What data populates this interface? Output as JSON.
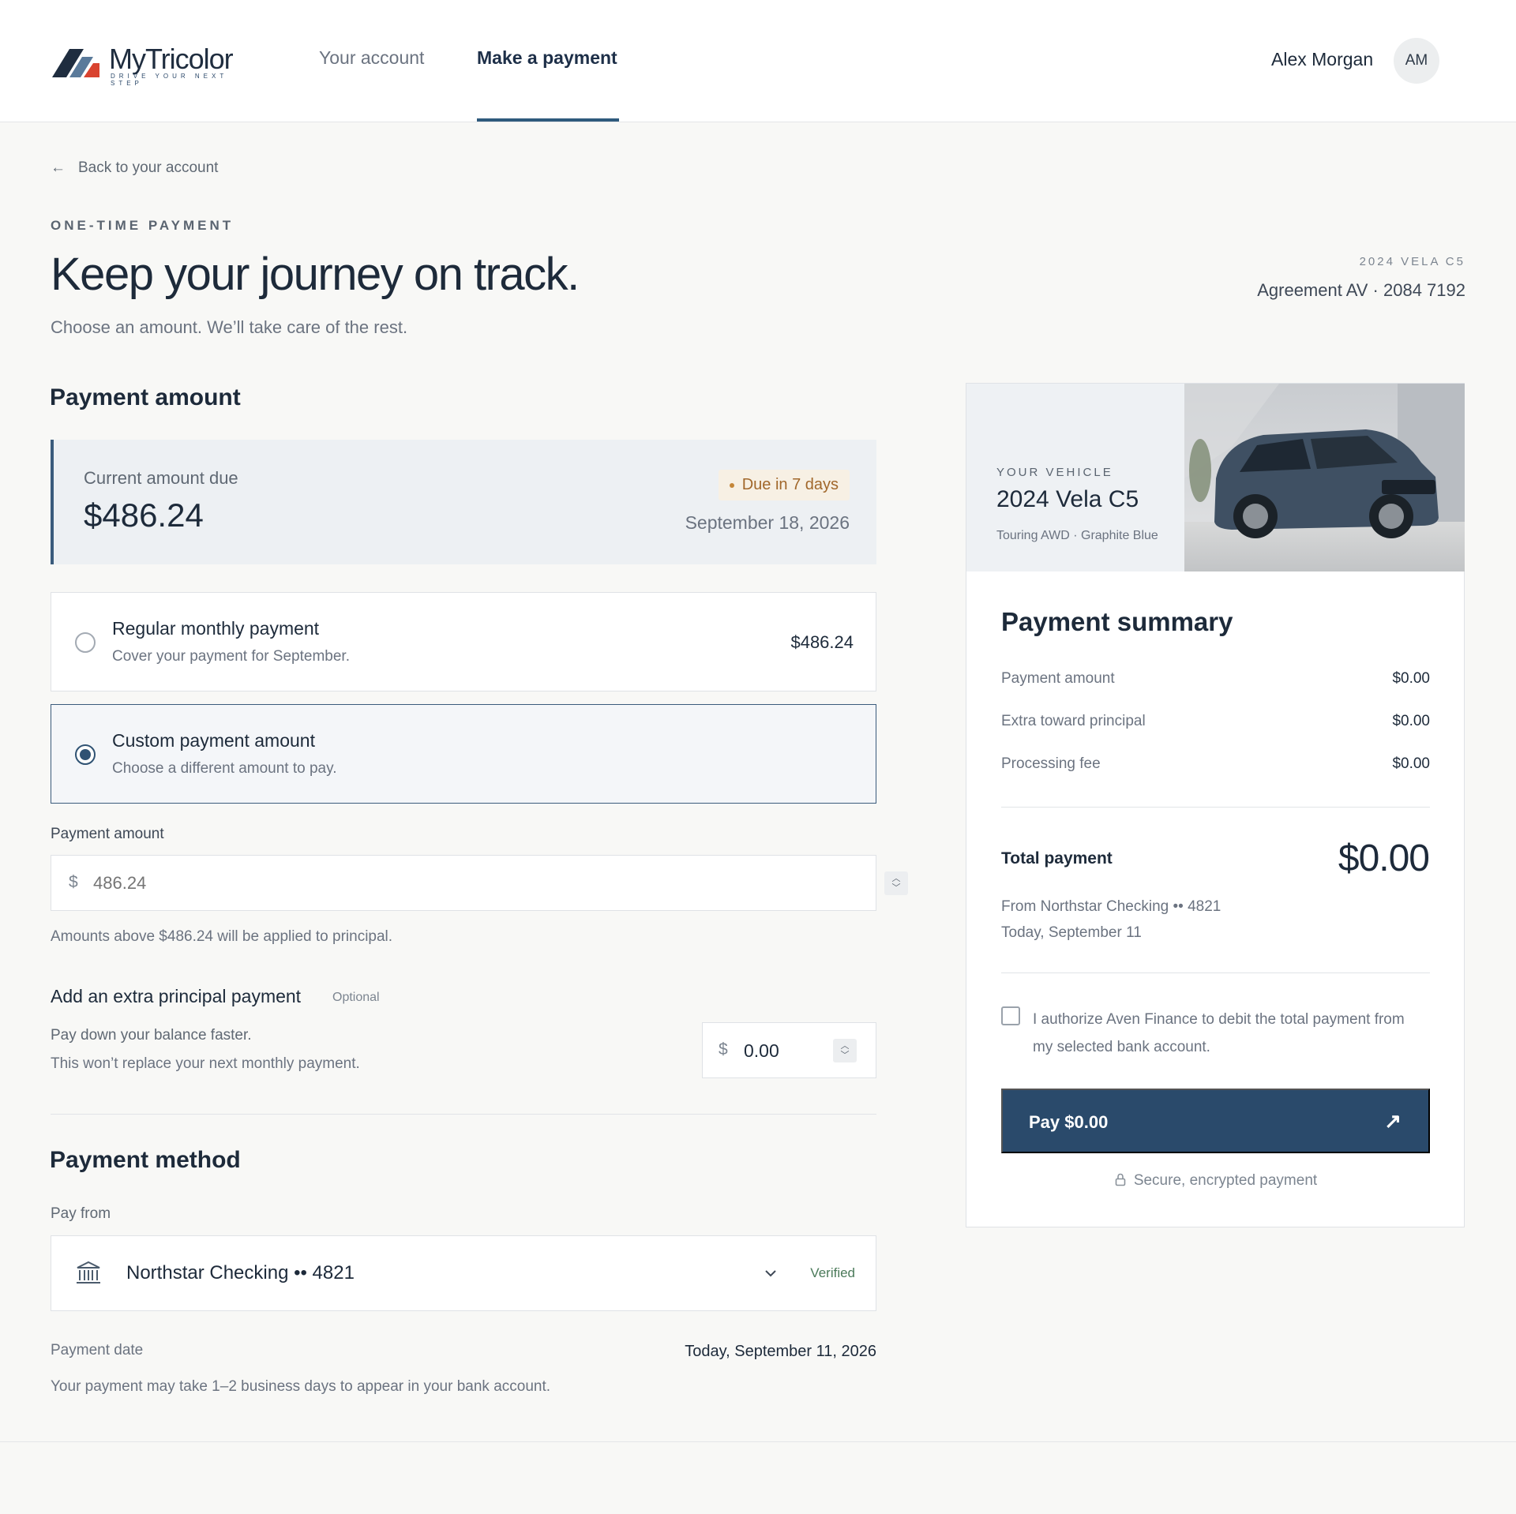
{
  "brand": {
    "name": "MyTricolor",
    "tagline": "DRIVE YOUR NEXT STEP",
    "colors": {
      "navy": "#1f2d3f",
      "blue": "#5a7a9a",
      "red": "#d9432f",
      "accent": "#2a4a6b"
    }
  },
  "nav": {
    "items": [
      {
        "label": "Your account",
        "active": false
      },
      {
        "label": "Make a payment",
        "active": true
      }
    ]
  },
  "user": {
    "name": "Alex Morgan",
    "initials": "AM"
  },
  "back_link": {
    "arrow": "←",
    "label": "Back to your account"
  },
  "hero": {
    "eyebrow": "ONE-TIME PAYMENT",
    "title": "Keep your journey on track.",
    "subtitle": "Choose an amount. We’ll take care of the rest.",
    "vehicle_eyebrow": "2024 VELA C5",
    "agreement": "Agreement AV · 2084 7192"
  },
  "payment_amount": {
    "section_title": "Payment amount",
    "due": {
      "label": "Current amount due",
      "amount": "$486.24",
      "badge": "Due in 7 days",
      "date": "September 18, 2026"
    },
    "options": [
      {
        "title": "Regular monthly payment",
        "description": "Cover your payment for September.",
        "amount": "$486.24",
        "selected": false
      },
      {
        "title": "Custom payment amount",
        "description": "Choose a different amount to pay.",
        "amount": "",
        "selected": true
      }
    ],
    "input_label": "Payment amount",
    "currency": "$",
    "input_placeholder": "486.24",
    "input_value": "",
    "helper": "Amounts above $486.24 will be applied to principal."
  },
  "extra_principal": {
    "title": "Add an extra principal payment",
    "optional": "Optional",
    "line1": "Pay down your balance faster.",
    "line2": "This won’t replace your next monthly payment.",
    "currency": "$",
    "value": "0.00"
  },
  "payment_method": {
    "section_title": "Payment method",
    "pay_from_label": "Pay from",
    "account": "Northstar Checking •• 4821",
    "verified": "Verified",
    "date_label": "Payment date",
    "date_value": "Today, September 11, 2026",
    "note": "Your payment may take 1–2 business days to appear in your bank account."
  },
  "vehicle": {
    "eyebrow": "YOUR VEHICLE",
    "name": "2024 Vela C5",
    "trim": "Touring AWD · Graphite Blue"
  },
  "summary": {
    "title": "Payment summary",
    "rows": [
      {
        "label": "Payment amount",
        "value": "$0.00"
      },
      {
        "label": "Extra toward principal",
        "value": "$0.00"
      },
      {
        "label": "Processing fee",
        "value": "$0.00"
      }
    ],
    "total_label": "Total payment",
    "total_value": "$0.00",
    "from": "From Northstar Checking •• 4821",
    "when": "Today, September 11",
    "authorize": "I authorize Aven Finance to debit the total payment from my selected bank account.",
    "pay_button": "Pay $0.00",
    "pay_arrow": "↗",
    "secure": "Secure, encrypted payment"
  }
}
